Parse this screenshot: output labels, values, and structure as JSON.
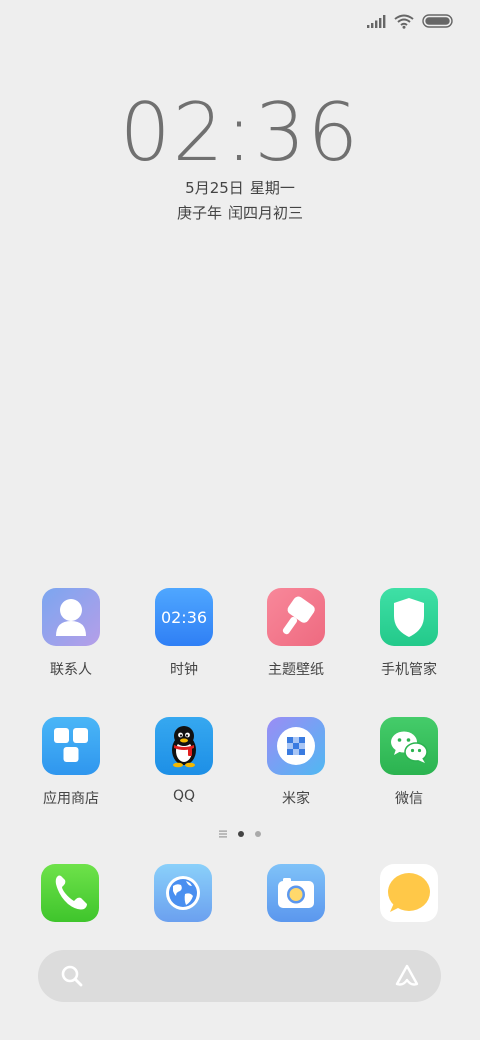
{
  "status_bar": {
    "icons": [
      "signal-icon",
      "wifi-icon",
      "battery-icon"
    ]
  },
  "lockclock": {
    "time": "02:36",
    "date": "5月25日",
    "weekday": "星期一",
    "lunar_year": "庚子年",
    "lunar_date": "闰四月初三"
  },
  "apps": [
    {
      "label": "联系人",
      "icon": "contacts-icon"
    },
    {
      "label": "时钟",
      "icon": "clock-icon",
      "icon_text": "02:36"
    },
    {
      "label": "主题壁纸",
      "icon": "themes-icon"
    },
    {
      "label": "手机管家",
      "icon": "security-icon"
    },
    {
      "label": "应用商店",
      "icon": "app-store-icon"
    },
    {
      "label": "QQ",
      "icon": "qq-icon"
    },
    {
      "label": "米家",
      "icon": "mi-home-icon"
    },
    {
      "label": "微信",
      "icon": "wechat-icon"
    }
  ],
  "page_indicator": {
    "pages": 3,
    "current": 2
  },
  "dock": [
    "phone-icon",
    "browser-icon",
    "camera-icon",
    "messages-icon"
  ],
  "search": {
    "icons": [
      "search-icon",
      "assistant-icon"
    ]
  }
}
